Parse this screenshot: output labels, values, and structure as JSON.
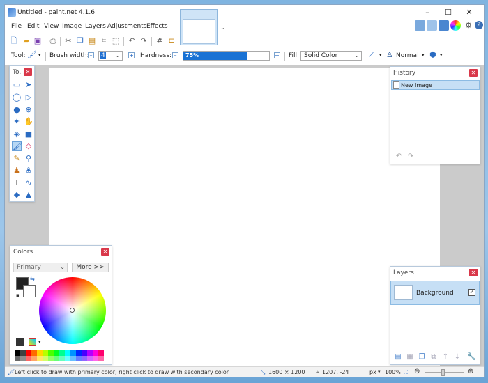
{
  "app": {
    "title": "Untitled - paint.net 4.1.6"
  },
  "window_controls": {
    "minimize": "–",
    "maximize": "☐",
    "close": "✕"
  },
  "menu": [
    "File",
    "Edit",
    "View",
    "Image",
    "Layers",
    "Adjustments",
    "Effects"
  ],
  "icons": {
    "new": "new-file-icon",
    "open": "open-folder-icon",
    "save": "save-icon",
    "print": "print-icon",
    "cut": "cut-icon",
    "copy": "copy-icon",
    "paste": "paste-icon",
    "crop": "crop-icon",
    "deselect": "deselect-icon",
    "undo": "undo-icon",
    "redo": "redo-icon",
    "grid": "grid-icon",
    "ruler": "ruler-icon"
  },
  "toolbar": {
    "tool_label": "Tool:",
    "brush_width_label": "Brush width:",
    "brush_width_value": "4",
    "hardness_label": "Hardness:",
    "hardness_value": "75%",
    "hardness_fraction": 0.75,
    "fill_label": "Fill:",
    "fill_value": "Solid Color",
    "blend_mode": "Normal"
  },
  "tools_panel": {
    "title": "To..."
  },
  "history_panel": {
    "title": "History",
    "items": [
      "New Image"
    ]
  },
  "colors_panel": {
    "title": "Colors",
    "mode": "Primary",
    "more_button": "More >>"
  },
  "layers_panel": {
    "title": "Layers",
    "layers": [
      {
        "name": "Background",
        "visible": true
      }
    ]
  },
  "status": {
    "hint": "Left click to draw with primary color, right click to draw with secondary color.",
    "image_size": "1600 × 1200",
    "cursor_pos": "1207, -24",
    "unit": "px",
    "zoom": "100%"
  },
  "colors": {
    "accent": "#1a72d4",
    "close_red": "#d9384a",
    "selection_blue": "#c6dff5",
    "palette": [
      "#000000",
      "#404040",
      "#ff0000",
      "#ff6a00",
      "#ffd800",
      "#b6ff00",
      "#4cff00",
      "#00ff21",
      "#00ff90",
      "#00ffff",
      "#0094ff",
      "#0026ff",
      "#4800ff",
      "#b200ff",
      "#ff00dc",
      "#ff006e"
    ]
  }
}
